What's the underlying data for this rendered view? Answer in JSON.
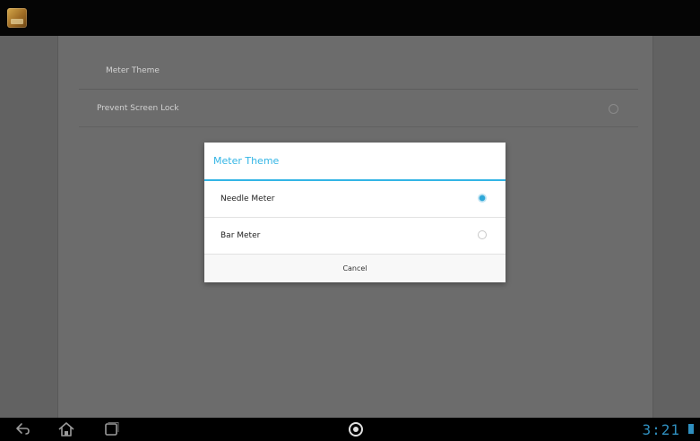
{
  "action_bar": {
    "app_icon": "app-icon"
  },
  "settings": {
    "items": [
      {
        "label": "Meter Theme"
      },
      {
        "label": "Prevent Screen Lock"
      }
    ]
  },
  "dialog": {
    "title": "Meter Theme",
    "options": [
      {
        "label": "Needle Meter",
        "selected": true
      },
      {
        "label": "Bar Meter",
        "selected": false
      }
    ],
    "cancel_label": "Cancel",
    "accent_color": "#33b5e5"
  },
  "system_bar": {
    "icons": [
      "back-icon",
      "home-icon",
      "recent-apps-icon",
      "center-app-icon"
    ],
    "clock": "3:21",
    "clock_color": "#2f8fbf"
  }
}
